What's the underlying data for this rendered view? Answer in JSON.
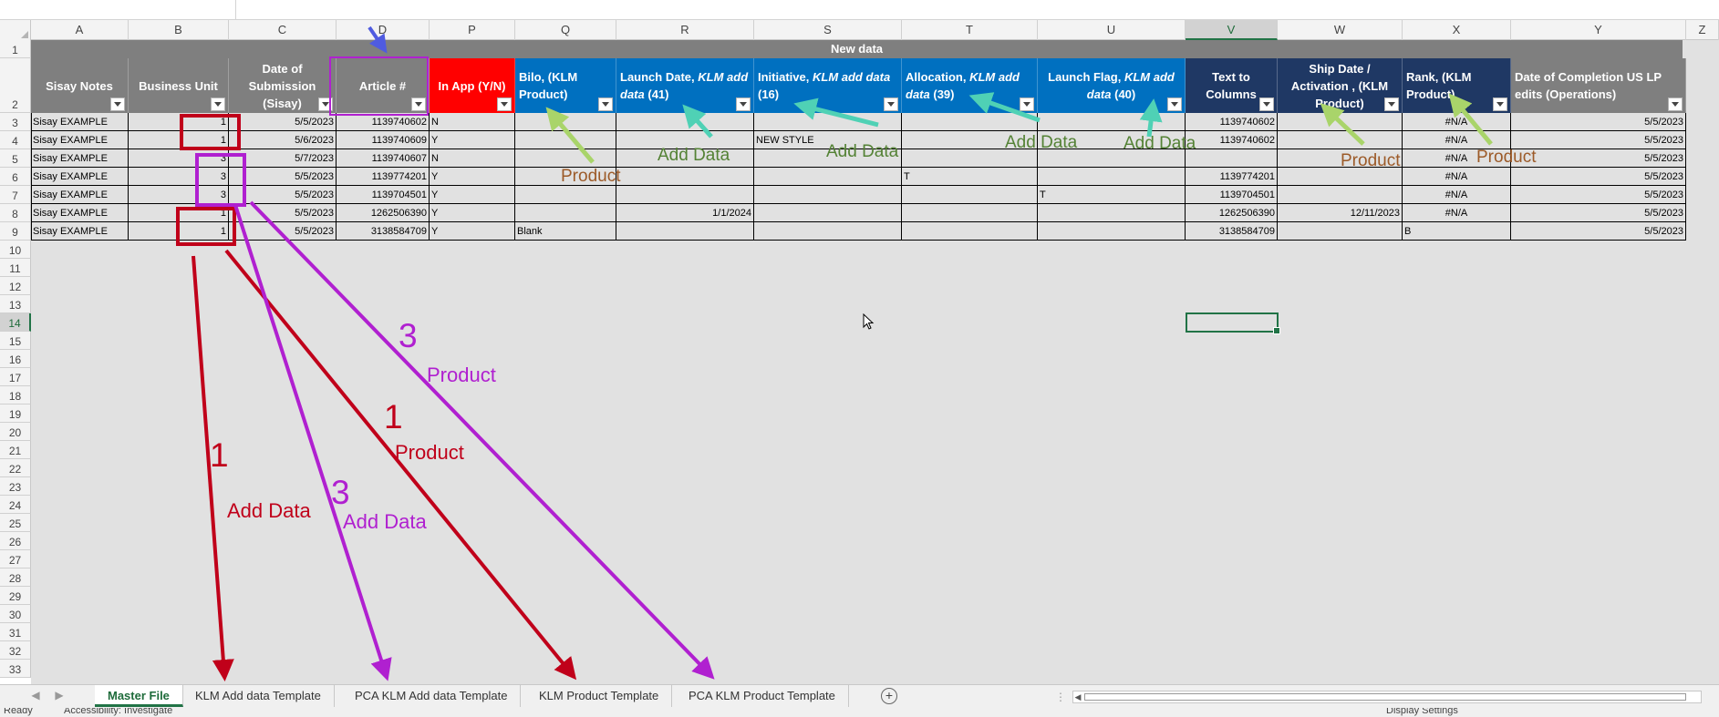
{
  "columns": [
    "A",
    "B",
    "C",
    "P",
    "Q",
    "R",
    "S",
    "T",
    "U",
    "V",
    "W",
    "X",
    "Y",
    "Z"
  ],
  "obscured_column": "D",
  "selected_column": "V",
  "rows": [
    "1",
    "2",
    "3",
    "4",
    "5",
    "6",
    "7",
    "8",
    "9",
    "10",
    "11",
    "12",
    "13",
    "14",
    "15",
    "16",
    "17",
    "18",
    "19",
    "20",
    "21",
    "22",
    "23",
    "24",
    "25",
    "26",
    "27",
    "28",
    "29",
    "30",
    "31",
    "32",
    "33"
  ],
  "selected_row": "14",
  "band_title": "New data",
  "headers": {
    "sisay_notes": "Sisay Notes",
    "business_unit": "Business Unit",
    "date_of_submission": "Date of Submission (Sisay)",
    "article": "Article #",
    "in_app": "In App (Y/N)",
    "bilo_a": "Bilo, (KLM",
    "bilo_b": "Product)",
    "launch_date_a": "Launch Date,",
    "launch_date_b": "KLM add",
    "launch_date_c": "data",
    "launch_date_d": "(41)",
    "initiative_a": "Initiative,",
    "initiative_b": "KLM add data",
    "initiative_c": "(16)",
    "allocation_a": "Allocation,",
    "allocation_b": "KLM add",
    "allocation_c": "data",
    "allocation_d": "(39)",
    "launch_flag_a": "Launch Flag,",
    "launch_flag_b": "KLM add",
    "launch_flag_c": "data",
    "launch_flag_d": "(40)",
    "text_to_columns": "Text to Columns",
    "ship_date": "Ship Date / Activation , (KLM Product)",
    "rank_a": "Rank, (KLM",
    "rank_b": "Product)",
    "date_completion": "Date of Completion US LP edits (Operations)"
  },
  "table_rows": [
    {
      "notes": "Sisay EXAMPLE",
      "bu": "1",
      "date": "5/5/2023",
      "article": "1139740602",
      "in_app": "N",
      "bilo": "",
      "launch_date": "",
      "initiative": "",
      "allocation": "",
      "launch_flag": "",
      "ttc": "1139740602",
      "ship": "",
      "rank": "#N/A",
      "completion": "5/5/2023"
    },
    {
      "notes": "Sisay EXAMPLE",
      "bu": "1",
      "date": "5/6/2023",
      "article": "1139740609",
      "in_app": "Y",
      "bilo": "",
      "launch_date": "",
      "initiative": "NEW STYLE",
      "allocation": "",
      "launch_flag": "",
      "ttc": "1139740602",
      "ship": "",
      "rank": "#N/A",
      "completion": "5/5/2023"
    },
    {
      "notes": "Sisay EXAMPLE",
      "bu": "3",
      "date": "5/7/2023",
      "article": "1139740607",
      "in_app": "N",
      "bilo": "",
      "launch_date": "",
      "initiative": "",
      "allocation": "",
      "launch_flag": "",
      "ttc": "",
      "ship": "",
      "rank": "#N/A",
      "completion": "5/5/2023"
    },
    {
      "notes": "Sisay EXAMPLE",
      "bu": "3",
      "date": "5/5/2023",
      "article": "1139774201",
      "in_app": "Y",
      "bilo": "",
      "launch_date": "",
      "initiative": "",
      "allocation": "T",
      "launch_flag": "",
      "ttc": "1139774201",
      "ship": "",
      "rank": "#N/A",
      "completion": "5/5/2023"
    },
    {
      "notes": "Sisay EXAMPLE",
      "bu": "3",
      "date": "5/5/2023",
      "article": "1139704501",
      "in_app": "Y",
      "bilo": "",
      "launch_date": "",
      "initiative": "",
      "allocation": "",
      "launch_flag": "T",
      "ttc": "1139704501",
      "ship": "",
      "rank": "#N/A",
      "completion": "5/5/2023"
    },
    {
      "notes": "Sisay EXAMPLE",
      "bu": "1",
      "date": "5/5/2023",
      "article": "1262506390",
      "in_app": "Y",
      "bilo": "",
      "launch_date": "1/1/2024",
      "initiative": "",
      "allocation": "",
      "launch_flag": "",
      "ttc": "1262506390",
      "ship": "12/11/2023",
      "rank": "#N/A",
      "completion": "5/5/2023"
    },
    {
      "notes": "Sisay EXAMPLE",
      "bu": "1",
      "date": "5/5/2023",
      "article": "3138584709",
      "in_app": "Y",
      "bilo": "Blank",
      "launch_date": "",
      "initiative": "",
      "allocation": "",
      "launch_flag": "",
      "ttc": "3138584709",
      "ship": "",
      "rank": "B",
      "completion": "5/5/2023"
    }
  ],
  "annotations": {
    "product": "Product",
    "add_data": "Add Data",
    "num_1": "1",
    "num_3": "3"
  },
  "colors": {
    "header_gray": "#7f7f7f",
    "header_red": "#ff0000",
    "header_blue": "#0070c0",
    "header_navy": "#1f3864",
    "excel_green": "#217346",
    "anno_red": "#c0001a",
    "anno_purple": "#b020d0",
    "anno_green_text": "#548235",
    "anno_brown_text": "#9c5a28",
    "arrow_light_green": "#a9d46a",
    "arrow_teal": "#4fd1b5",
    "arrow_blue": "#4f5be0"
  },
  "sheet_tabs": [
    "Master File",
    "KLM Add data Template",
    "PCA KLM Add data Template",
    "KLM Product Template",
    "PCA KLM Product Template"
  ],
  "active_tab": "Master File",
  "status": {
    "ready": "Ready",
    "accessibility": "Accessibility: Investigate",
    "display_settings": "Display Settings"
  }
}
